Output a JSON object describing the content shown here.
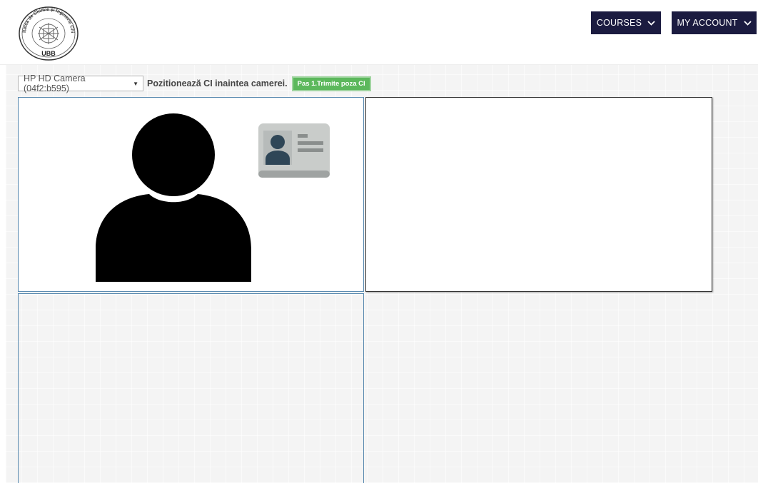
{
  "header": {
    "logo": {
      "top_text": "Facultatea de Chimie și Inginerie Chimică",
      "bottom_text": "UBB"
    },
    "nav": [
      {
        "label": "COURSES",
        "icon": "chevron-down-icon"
      },
      {
        "label": "MY ACCOUNT",
        "icon": "chevron-down-icon"
      }
    ]
  },
  "toolbar": {
    "camera_select_value": "HP HD Camera (04f2:b595)",
    "instruction": "Pozitionează CI inaintea camerei.",
    "step_button": "Pas 1.Trimite poza CI"
  },
  "panels": {
    "camera_preview": {
      "icon": "person-silhouette-icon",
      "badge_icon": "id-card-icon"
    },
    "capture_preview": {},
    "empty_panel": {}
  },
  "colors": {
    "nav_bg": "#1b1b40",
    "step_button_bg": "#5cb85c",
    "panel_border": "#5a8ab0",
    "background": "#f4f4f4"
  }
}
